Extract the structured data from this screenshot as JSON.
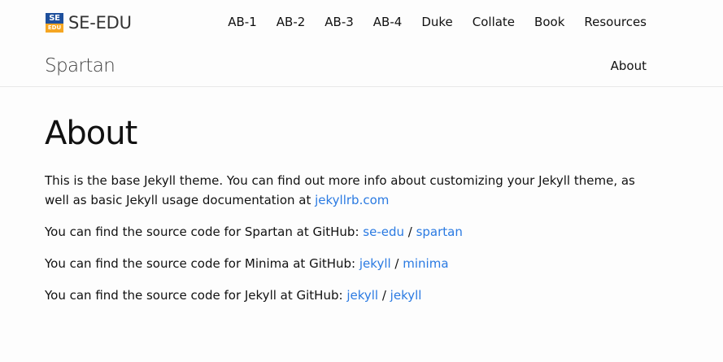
{
  "header": {
    "brand": {
      "logo_top": "SE",
      "logo_bottom": "EDU",
      "name": "SE-EDU"
    },
    "nav": [
      "AB-1",
      "AB-2",
      "AB-3",
      "AB-4",
      "Duke",
      "Collate",
      "Book",
      "Resources"
    ]
  },
  "site": {
    "title": "Spartan",
    "nav_about": "About"
  },
  "main": {
    "title": "About",
    "intro": {
      "text": "This is the base Jekyll theme. You can find out more info about customizing your Jekyll theme, as well as basic Jekyll usage documentation at ",
      "link": "jekyllrb.com"
    },
    "sources": [
      {
        "text": "You can find the source code for Spartan at GitHub: ",
        "owner": "se-edu",
        "sep": " / ",
        "repo": "spartan"
      },
      {
        "text": "You can find the source code for Minima at GitHub: ",
        "owner": "jekyll",
        "sep": " / ",
        "repo": "minima"
      },
      {
        "text": "You can find the source code for Jekyll at GitHub: ",
        "owner": "jekyll",
        "sep": " / ",
        "repo": "jekyll"
      }
    ]
  },
  "colors": {
    "link": "#2a7ae2",
    "logo_blue": "#1d4f9c",
    "logo_orange": "#f5a623"
  }
}
